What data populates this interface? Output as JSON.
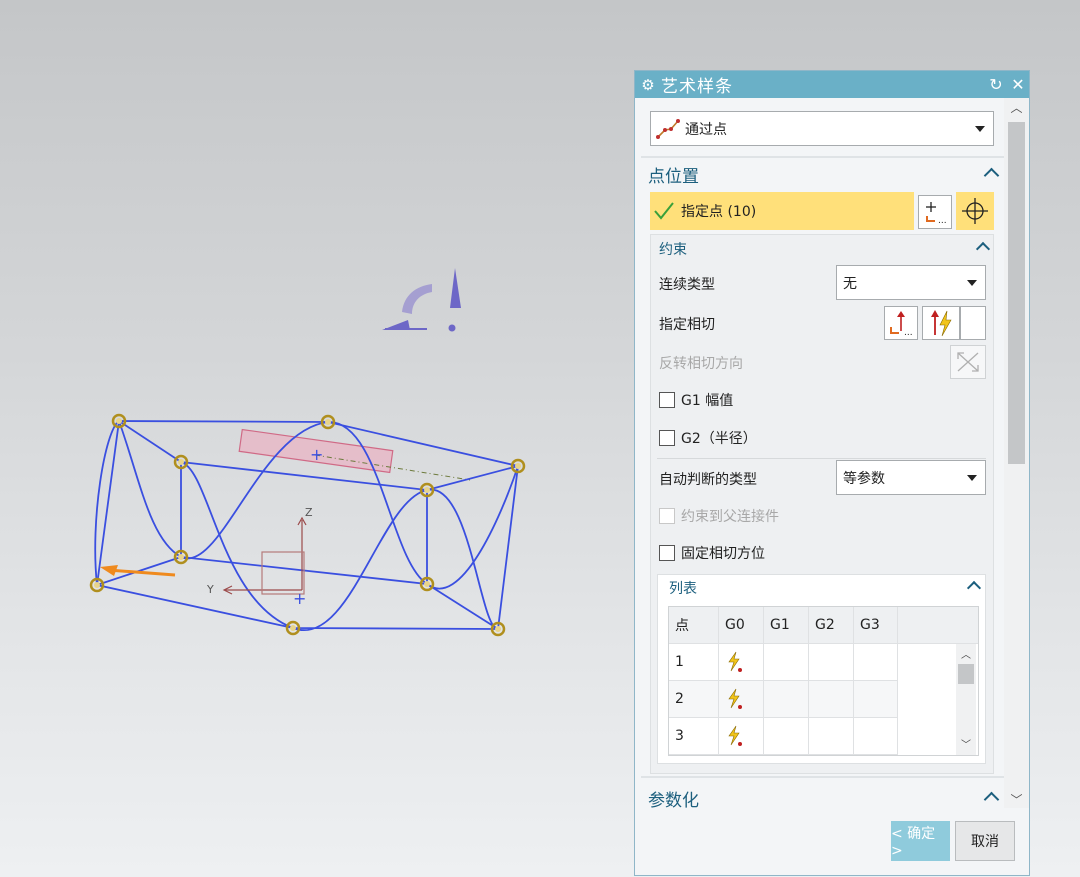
{
  "viewport": {
    "axis_labels": {
      "z": "Z",
      "y": "Y"
    }
  },
  "dialog": {
    "title": "艺术样条",
    "type_select": "通过点",
    "sections": {
      "point_position": "点位置",
      "constraints": "约束",
      "list": "列表",
      "parameterization": "参数化"
    },
    "specify_point": "指定点 (10)",
    "continuity_type_label": "连续类型",
    "continuity_type_value": "无",
    "specify_tangent_label": "指定相切",
    "reverse_tangent_label": "反转相切方向",
    "g1_label": "G1 幅值",
    "g2_label": "G2（半径）",
    "auto_type_label": "自动判断的类型",
    "auto_type_value": "等参数",
    "constrain_parent_label": "约束到父连接件",
    "fix_tangent_label": "固定相切方位",
    "table": {
      "headers": [
        "点",
        "G0",
        "G1",
        "G2",
        "G3"
      ],
      "rows": [
        "1",
        "2",
        "3"
      ]
    },
    "ok_label": "< 确定 >",
    "cancel_label": "取消"
  },
  "colors": {
    "title_bar": "#6ab0c7",
    "highlight": "#ffe07a",
    "curve": "#3a4fe0",
    "accent_text": "#1c5f7e"
  }
}
